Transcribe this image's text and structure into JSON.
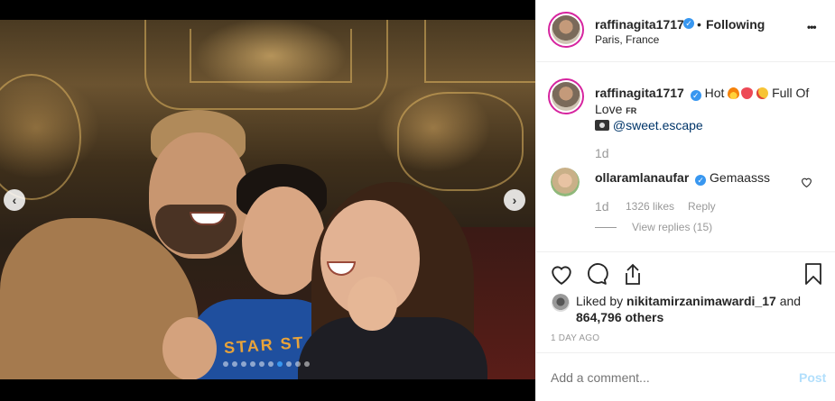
{
  "post": {
    "username": "raffinagita1717",
    "location": "Paris, France",
    "following_label": "Following",
    "separator": "•",
    "more_label": "•••"
  },
  "caption": {
    "username": "raffinagita1717",
    "text_hot": "Hot",
    "text_full": "Full Of",
    "text_love": "Love",
    "text_fr": "FR",
    "mention": "@sweet.escape",
    "time": "1d"
  },
  "comments": [
    {
      "username": "ollaramlanaufar",
      "text": "Gemaasss",
      "time": "1d",
      "likes": "1326 likes",
      "reply_label": "Reply",
      "view_replies": "View replies (15)"
    }
  ],
  "likes": {
    "prefix": "Liked by",
    "username": "nikitamirzanimawardi_17",
    "and": "and",
    "others": "864,796 others",
    "date": "1 DAY AGO"
  },
  "comment_box": {
    "placeholder": "Add a comment...",
    "post_label": "Post"
  },
  "carousel": {
    "prev": "‹",
    "next": "›",
    "photo_text": "STAR ST"
  },
  "colors": {
    "verified": "#3897f0",
    "heart_red": "#ed4956",
    "fire": "#f5820b",
    "link": "#003569",
    "post_disabled": "#b2dffc"
  }
}
